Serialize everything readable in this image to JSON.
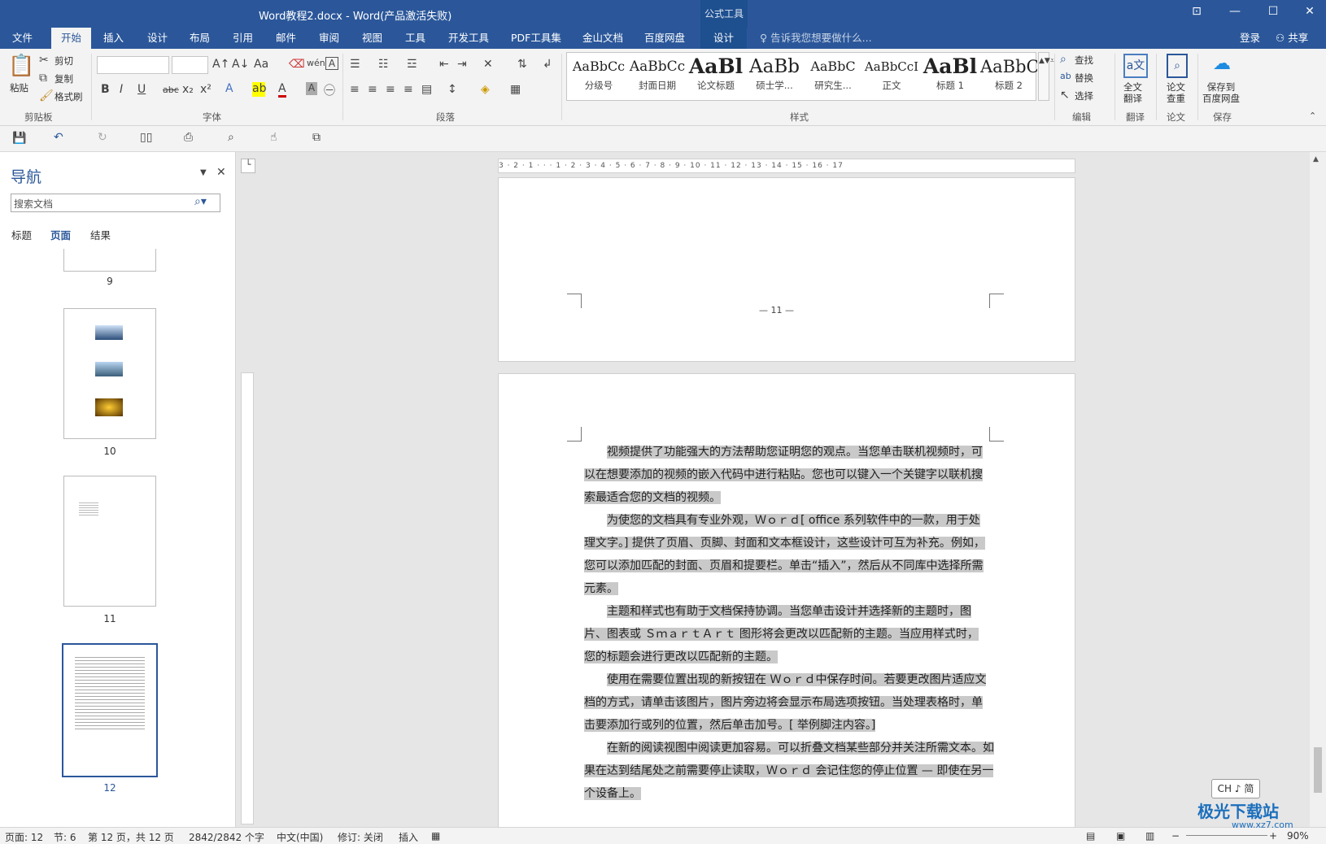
{
  "titlebar": {
    "title": "Word教程2.docx - Word(产品激活失败)",
    "context_group": "公式工具",
    "buttons": [
      "⊡",
      "—",
      "☐",
      "✕"
    ]
  },
  "tabs": [
    "文件",
    "开始",
    "插入",
    "设计",
    "布局",
    "引用",
    "邮件",
    "审阅",
    "视图",
    "工具",
    "开发工具",
    "PDF工具集",
    "金山文档",
    "百度网盘",
    "设计"
  ],
  "active_tab": "开始",
  "tellme": "告诉我您想要做什么...",
  "login": "登录",
  "share": "共享",
  "ribbon": {
    "clipboard": {
      "paste": "粘贴",
      "cut": "剪切",
      "copy": "复制",
      "format_painter": "格式刷",
      "label": "剪贴板"
    },
    "font": {
      "label": "字体",
      "name": "",
      "size": ""
    },
    "paragraph": {
      "label": "段落"
    },
    "styles": {
      "label": "样式",
      "items": [
        {
          "sample": "AaBbCc",
          "name": "分级号"
        },
        {
          "sample": "AaBbCc",
          "name": "封面日期"
        },
        {
          "sample": "AaBl",
          "name": "论文标题"
        },
        {
          "sample": "AaBb",
          "name": "硕士学..."
        },
        {
          "sample": "AaBbC",
          "name": "研究生..."
        },
        {
          "sample": "AaBbCcI",
          "name": "正文"
        },
        {
          "sample": "AaBl",
          "name": "标题 1"
        },
        {
          "sample": "AaBbC",
          "name": "标题 2"
        }
      ]
    },
    "editing": {
      "find": "查找",
      "replace": "替换",
      "select": "选择",
      "label": "编辑"
    },
    "translate": {
      "btn": "全文\n翻译",
      "label": "翻译"
    },
    "paper": {
      "btn": "论文\n查重",
      "label": "论文"
    },
    "save": {
      "btn": "保存到\n百度网盘",
      "label": "保存"
    }
  },
  "nav": {
    "title": "导航",
    "search_placeholder": "搜索文档",
    "tabs": [
      "标题",
      "页面",
      "结果"
    ],
    "active_tab": "页面",
    "pages": [
      "9",
      "10",
      "11",
      "12"
    ],
    "current_page": "12"
  },
  "ruler": {
    "text": "3 · 2 · 1 · · · 1 · 2 · 3 · 4 · 5 · 6 · 7 · 8 · 9 · 10 · 11 · 12 · 13 · 14 · 15 · 16 · 17"
  },
  "document": {
    "page_footer": "— 11 —",
    "paragraphs": [
      "视频提供了功能强大的方法帮助您证明您的观点。当您单击联机视频时，可以在想要添加的视频的嵌入代码中进行粘贴。您也可以键入一个关键字以联机搜索最适合您的文档的视频。",
      "为使您的文档具有专业外观，Ｗｏｒｄ[ office 系列软件中的一款，用于处理文字。] 提供了页眉、页脚、封面和文本框设计，这些设计可互为补充。例如，您可以添加匹配的封面、页眉和提要栏。单击“插入”，然后从不同库中选择所需元素。",
      "主题和样式也有助于文档保持协调。当您单击设计并选择新的主题时，图片、图表或 ＳｍａｒｔＡｒｔ 图形将会更改以匹配新的主题。当应用样式时，您的标题会进行更改以匹配新的主题。",
      "使用在需要位置出现的新按钮在 Ｗｏｒｄ中保存时间。若要更改图片适应文档的方式，请单击该图片，图片旁边将会显示布局选项按钮。当处理表格时，单击要添加行或列的位置，然后单击加号。[ 举例脚注内容。]",
      "在新的阅读视图中阅读更加容易。可以折叠文档某些部分并关注所需文本。如果在达到结尾处之前需要停止读取，Ｗｏｒｄ 会记住您的停止位置 — 即使在另一个设备上。"
    ]
  },
  "statusbar": {
    "page": "页面: 12",
    "section": "节: 6",
    "page_of": "第 12 页，共 12 页",
    "words": "2842/2842 个字",
    "language": "中文(中国)",
    "track": "修订: 关闭",
    "insert": "插入",
    "zoom": "90%"
  },
  "ime": "CH ♪ 简",
  "watermark": {
    "text": "极光下载站",
    "url": "www.xz7.com"
  },
  "colors": {
    "accent": "#2b579a",
    "selection": "#c9c9c9"
  }
}
